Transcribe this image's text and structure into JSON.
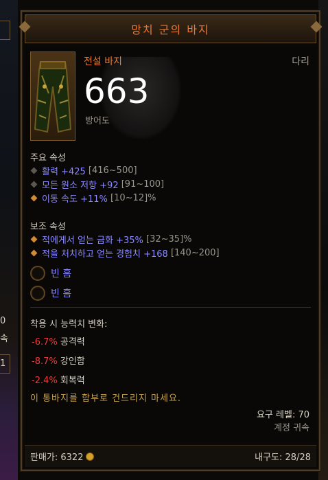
{
  "background": {
    "left_numbers": [
      "0",
      "속",
      "1"
    ]
  },
  "tooltip": {
    "title": "망치 군의 바지",
    "rarity_type": "전설 바지",
    "slot": "다리",
    "armor_value": "663",
    "armor_label": "방어도",
    "primary": {
      "heading": "주요 속성",
      "stats": [
        {
          "value": "활력 +425",
          "range": "[416~500]",
          "bullet": "gray"
        },
        {
          "value": "모든 원소 저항 +92",
          "range": "[91~100]",
          "bullet": "gray"
        },
        {
          "value": "이동 속도 +11%",
          "range": "[10~12]%",
          "bullet": "orange"
        }
      ]
    },
    "secondary": {
      "heading": "보조 속성",
      "stats": [
        {
          "value": "적에게서 얻는 금화 +35%",
          "range": "[32~35]%",
          "bullet": "orange"
        },
        {
          "value": "적을 처치하고 얻는 경험치 +168",
          "range": "[140~200]",
          "bullet": "orange"
        }
      ]
    },
    "sockets": [
      {
        "label": "빈 홈"
      },
      {
        "label": "빈 홈"
      }
    ],
    "attribute_change": {
      "heading": "착용 시 능력치 변화:",
      "items": [
        {
          "delta": "-6.7%",
          "name": "공격력"
        },
        {
          "delta": "-8.7%",
          "name": "강인함"
        },
        {
          "delta": "-2.4%",
          "name": "회복력"
        }
      ]
    },
    "flavor_text": "이 통바지를 함부로 건드리지 마세요.",
    "required_level": "요구 레벨: 70",
    "account_bound": "계정 귀속",
    "footer": {
      "sell_price": "판매가: 6322",
      "durability": "내구도: 28/28"
    },
    "colors": {
      "legendary_orange": "#e8792e",
      "magic_blue": "#8a88ff",
      "negative_red": "#ef3a3a",
      "flavor_gold": "#c8a24c"
    }
  }
}
